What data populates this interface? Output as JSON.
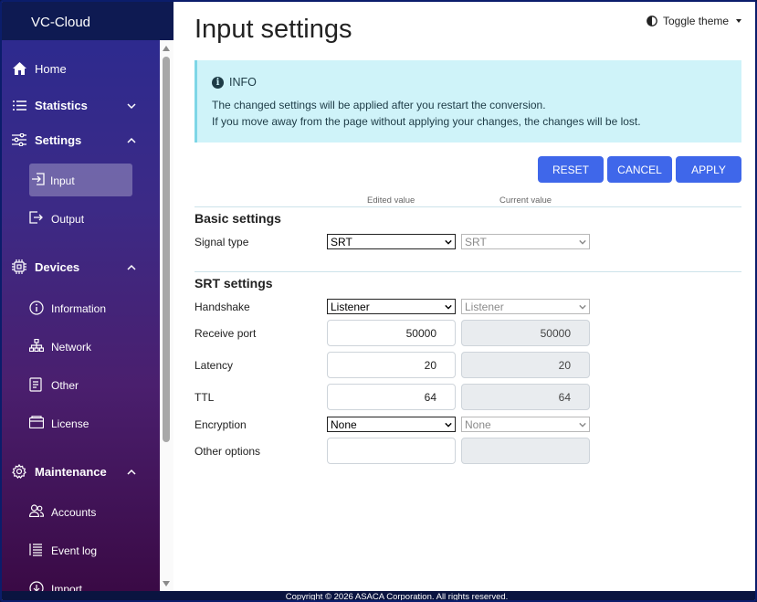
{
  "app": {
    "brand": "VC-Cloud"
  },
  "sidebar": {
    "items": [
      {
        "label": "Home",
        "icon": "home-icon"
      },
      {
        "label": "Statistics",
        "icon": "list-icon",
        "chevron": "chevron-down-icon"
      },
      {
        "label": "Settings",
        "icon": "sliders-icon",
        "chevron": "chevron-up-icon"
      },
      {
        "label": "Devices",
        "icon": "chip-icon",
        "chevron": "chevron-up-icon"
      },
      {
        "label": "Maintenance",
        "icon": "gear-icon",
        "chevron": "chevron-up-icon"
      }
    ],
    "settings_sub": [
      {
        "label": "Input",
        "icon": "input-icon",
        "active": true
      },
      {
        "label": "Output",
        "icon": "output-icon"
      }
    ],
    "devices_sub": [
      {
        "label": "Information",
        "icon": "info-circle-icon"
      },
      {
        "label": "Network",
        "icon": "network-icon"
      },
      {
        "label": "Other",
        "icon": "document-icon"
      },
      {
        "label": "License",
        "icon": "wallet-icon"
      }
    ],
    "maintenance_sub": [
      {
        "label": "Accounts",
        "icon": "users-icon"
      },
      {
        "label": "Event log",
        "icon": "log-icon"
      },
      {
        "label": "Import",
        "icon": "import-icon"
      }
    ]
  },
  "header": {
    "title": "Input settings",
    "theme_toggle": "Toggle theme"
  },
  "info": {
    "heading": "INFO",
    "line1": "The changed settings will be applied after you restart the conversion.",
    "line2": "If you move away from the page without applying your changes, the changes will be lost."
  },
  "buttons": {
    "reset": "RESET",
    "cancel": "CANCEL",
    "apply": "APPLY"
  },
  "columns": {
    "edited": "Edited value",
    "current": "Current value"
  },
  "basic": {
    "title": "Basic settings",
    "signal_type": {
      "label": "Signal type",
      "edited": "SRT",
      "current": "SRT"
    }
  },
  "srt": {
    "title": "SRT settings",
    "handshake": {
      "label": "Handshake",
      "edited": "Listener",
      "current": "Listener"
    },
    "receive_port": {
      "label": "Receive port",
      "edited": "50000",
      "current": "50000"
    },
    "latency": {
      "label": "Latency",
      "edited": "20",
      "current": "20"
    },
    "ttl": {
      "label": "TTL",
      "edited": "64",
      "current": "64"
    },
    "encryption": {
      "label": "Encryption",
      "edited": "None",
      "current": "None"
    },
    "other_options": {
      "label": "Other options",
      "edited": "",
      "current": ""
    }
  },
  "footer": {
    "copyright": "Copyright © 2026 ASACA Corporation. All rights reserved."
  },
  "colors": {
    "accent": "#3f67ea",
    "info_bg": "#cff3f9",
    "sidebar_top": "#2a2a90",
    "sidebar_bottom": "#3a0a45"
  }
}
